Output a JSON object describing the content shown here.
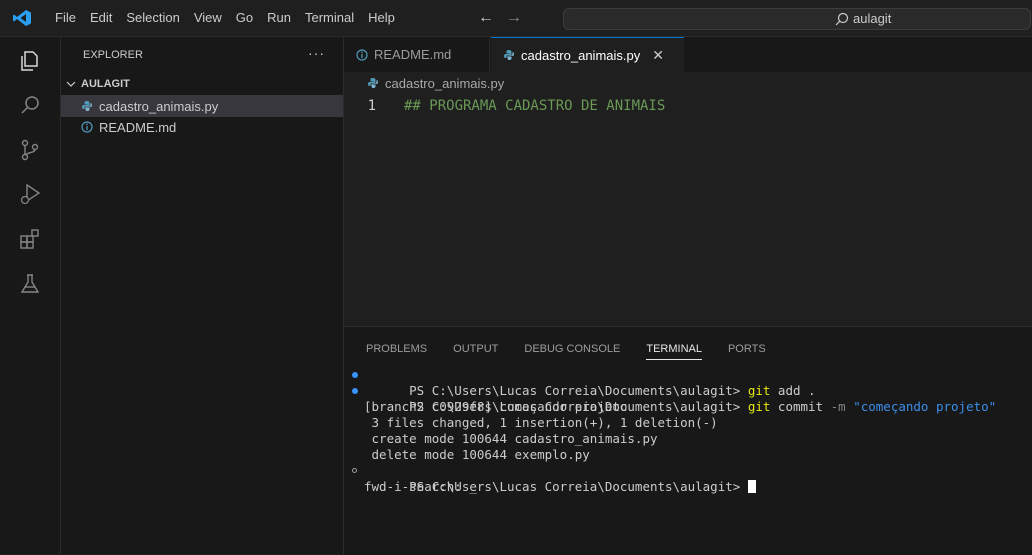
{
  "menu": [
    "File",
    "Edit",
    "Selection",
    "View",
    "Go",
    "Run",
    "Terminal",
    "Help"
  ],
  "nav": {
    "back_icon": "←",
    "forward_icon": "→"
  },
  "search": {
    "text": "aulagit"
  },
  "activity_icons": [
    "explorer-icon",
    "search-icon",
    "source-control-icon",
    "run-debug-icon",
    "extensions-icon",
    "testing-icon"
  ],
  "sidebar": {
    "header": "EXPLORER",
    "more": "···",
    "folder": "AULAGIT",
    "files": [
      {
        "name": "cadastro_animais.py",
        "icon": "python-file-icon",
        "active": true
      },
      {
        "name": "README.md",
        "icon": "info-icon",
        "active": false
      }
    ]
  },
  "tabs": [
    {
      "label": "README.md",
      "icon": "info-icon",
      "active": false
    },
    {
      "label": "cadastro_animais.py",
      "icon": "python-file-icon",
      "active": true,
      "close": "✕"
    }
  ],
  "breadcrumb": "cadastro_animais.py",
  "editor": {
    "lines": [
      {
        "number": "1",
        "text": "## PROGRAMA CADASTRO DE ANIMAIS"
      }
    ]
  },
  "panel": {
    "tabs": [
      "PROBLEMS",
      "OUTPUT",
      "DEBUG CONSOLE",
      "TERMINAL",
      "PORTS"
    ],
    "active_tab": "TERMINAL"
  },
  "terminal": {
    "line1": {
      "prompt": "PS C:\\Users\\Lucas Correia\\Documents\\aulagit> ",
      "cmd": "git",
      "rest": " add ."
    },
    "line2": {
      "prompt": "PS C:\\Users\\Lucas Correia\\Documents\\aulagit> ",
      "cmd": "git",
      "rest": " commit ",
      "flag": "-m",
      "str": " \"começando projeto\""
    },
    "line3": "[branch2 c0929f8] começando projeto",
    "line4": " 3 files changed, 1 insertion(+), 1 deletion(-)",
    "line5": " create mode 100644 cadastro_animais.py",
    "line6": " delete mode 100644 exemplo.py",
    "line7": "PS C:\\Users\\Lucas Correia\\Documents\\aulagit> ",
    "line8": "fwd-i-search: _"
  },
  "colors": {
    "accent": "#0078d4",
    "comment": "#6a9955",
    "git_cmd": "#e5e510",
    "string": "#3b8eea",
    "python_icon": "#519aba"
  }
}
